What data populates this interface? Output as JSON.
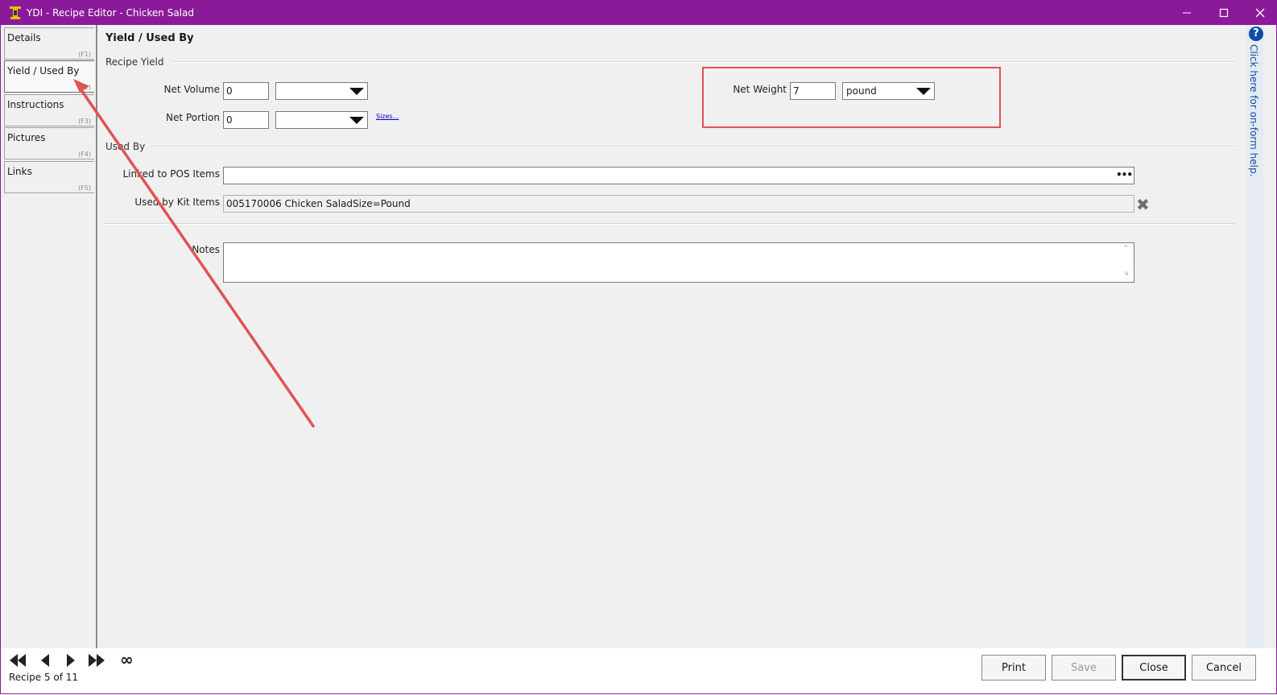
{
  "window": {
    "title": "YDI - Recipe Editor - Chicken Salad",
    "minimize_glyph": "—",
    "maximize_glyph": "☐",
    "close_glyph": "✕"
  },
  "tabs": [
    {
      "label": "Details",
      "key": "(F1)"
    },
    {
      "label": "Yield / Used By",
      "key": "(F2)"
    },
    {
      "label": "Instructions",
      "key": "(F3)"
    },
    {
      "label": "Pictures",
      "key": "(F4)"
    },
    {
      "label": "Links",
      "key": "(F5)"
    }
  ],
  "active_tab": "Yield / Used By",
  "section_title": "Yield / Used By",
  "recipe_yield": {
    "group_label": "Recipe Yield",
    "net_volume": {
      "label": "Net Volume",
      "value": "0",
      "unit": ""
    },
    "net_portion": {
      "label": "Net Portion",
      "value": "0",
      "unit": "",
      "sizes_link": "Sizes..."
    },
    "net_weight": {
      "label": "Net Weight",
      "value": "7",
      "unit": "pound"
    }
  },
  "used_by": {
    "group_label": "Used By",
    "linked_pos": {
      "label": "Linked to POS Items",
      "value": "",
      "browse": "•••"
    },
    "kit_items": {
      "label": "Used by Kit Items",
      "value": "005170006 Chicken SaladSize=Pound",
      "remove_glyph": "✖"
    },
    "notes": {
      "label": "Notes",
      "value": ""
    }
  },
  "help": {
    "icon": "?",
    "text": "Click here for on-form help."
  },
  "nav": {
    "first": "⏮",
    "prev": "◀",
    "next": "▶",
    "last": "⏭",
    "infinity": "∞",
    "record_info": "Recipe 5 of 11"
  },
  "buttons": {
    "print": "Print",
    "save": "Save",
    "close": "Close",
    "cancel": "Cancel"
  },
  "colors": {
    "titlebar": "#8b1a9a",
    "annotation": "#e05353",
    "help": "#0a4ea8"
  }
}
